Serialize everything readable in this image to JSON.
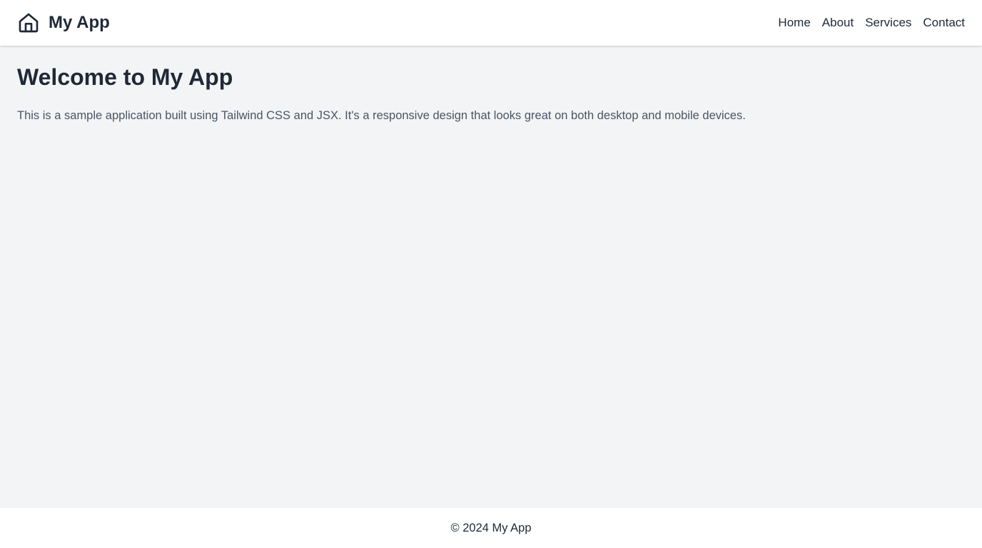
{
  "header": {
    "brand_icon": "home-icon",
    "app_title": "My App",
    "nav": [
      {
        "label": "Home"
      },
      {
        "label": "About"
      },
      {
        "label": "Services"
      },
      {
        "label": "Contact"
      }
    ]
  },
  "main": {
    "title": "Welcome to My App",
    "description": "This is a sample application built using Tailwind CSS and JSX. It's a responsive design that looks great on both desktop and mobile devices."
  },
  "footer": {
    "text": "© 2024 My App"
  },
  "colors": {
    "background": "#f3f4f6",
    "surface": "#ffffff",
    "text_primary": "#1f2937",
    "text_secondary": "#4b5563"
  }
}
